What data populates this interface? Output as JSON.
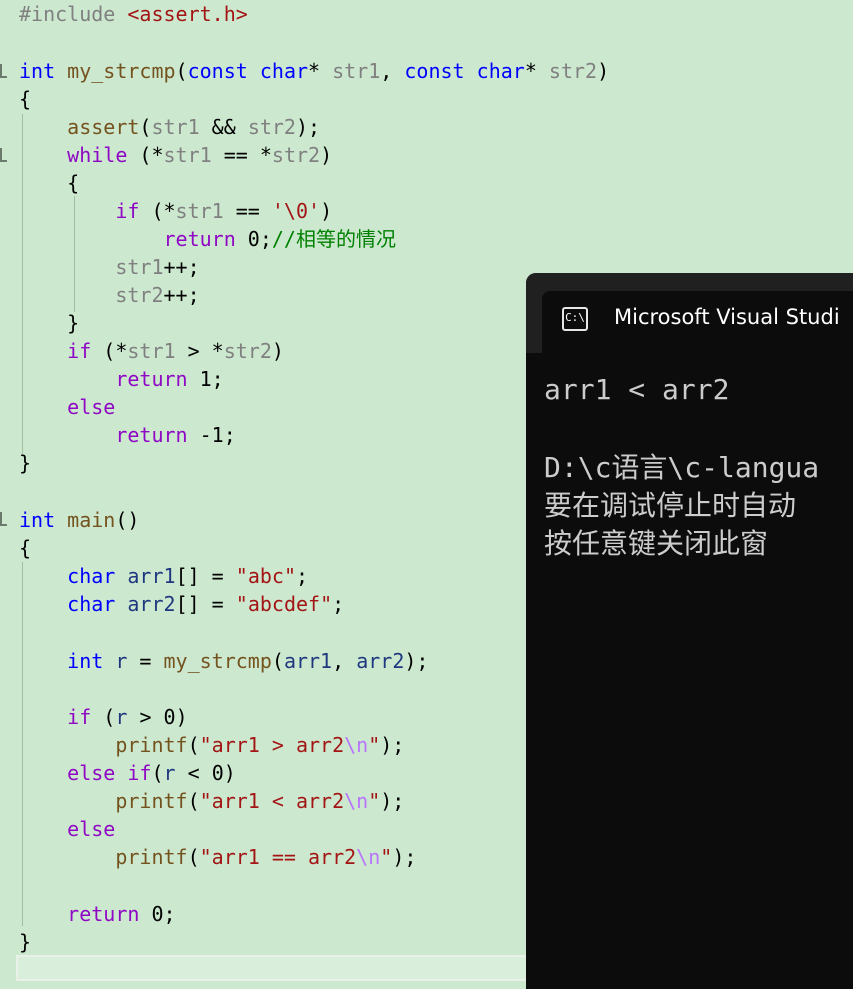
{
  "editor": {
    "include_directive": "#include",
    "include_header": "<assert.h>",
    "kw_int": "int",
    "kw_const": "const",
    "kw_char": "char",
    "kw_while": "while",
    "kw_if": "if",
    "kw_else": "else",
    "kw_return": "return",
    "fn_my_strcmp": "my_strcmp",
    "fn_main": "main",
    "fn_assert": "assert",
    "fn_printf": "printf",
    "param_str1": "str1",
    "param_str2": "str2",
    "var_arr1": "arr1",
    "var_arr2": "arr2",
    "var_r": "r",
    "char_null": "'\\0'",
    "comment_equal": "//相等的情况",
    "str_abc": "\"abc\"",
    "str_abcdef": "\"abcdef\"",
    "str_gt": "\"arr1 > arr2",
    "str_lt": "\"arr1 < arr2",
    "str_eq": "\"arr1 == arr2",
    "escape_n": "\\n",
    "quote_close": "\"",
    "num_0": "0",
    "num_1": "1",
    "num_neg1": "-1"
  },
  "console": {
    "icon_label": "C:\\",
    "title": "Microsoft Visual Studi",
    "output_line": "arr1 < arr2",
    "path_line": "D:\\c语言\\c-langua",
    "msg_line1": "要在调试停止时自动",
    "msg_line2": "按任意键关闭此窗"
  },
  "colors": {
    "editor_bg": "#cce8cf",
    "console_bg": "#0c0c0c",
    "keyword": "#0000ff",
    "control": "#8f08c4",
    "string": "#a31515",
    "comment": "#008000"
  }
}
